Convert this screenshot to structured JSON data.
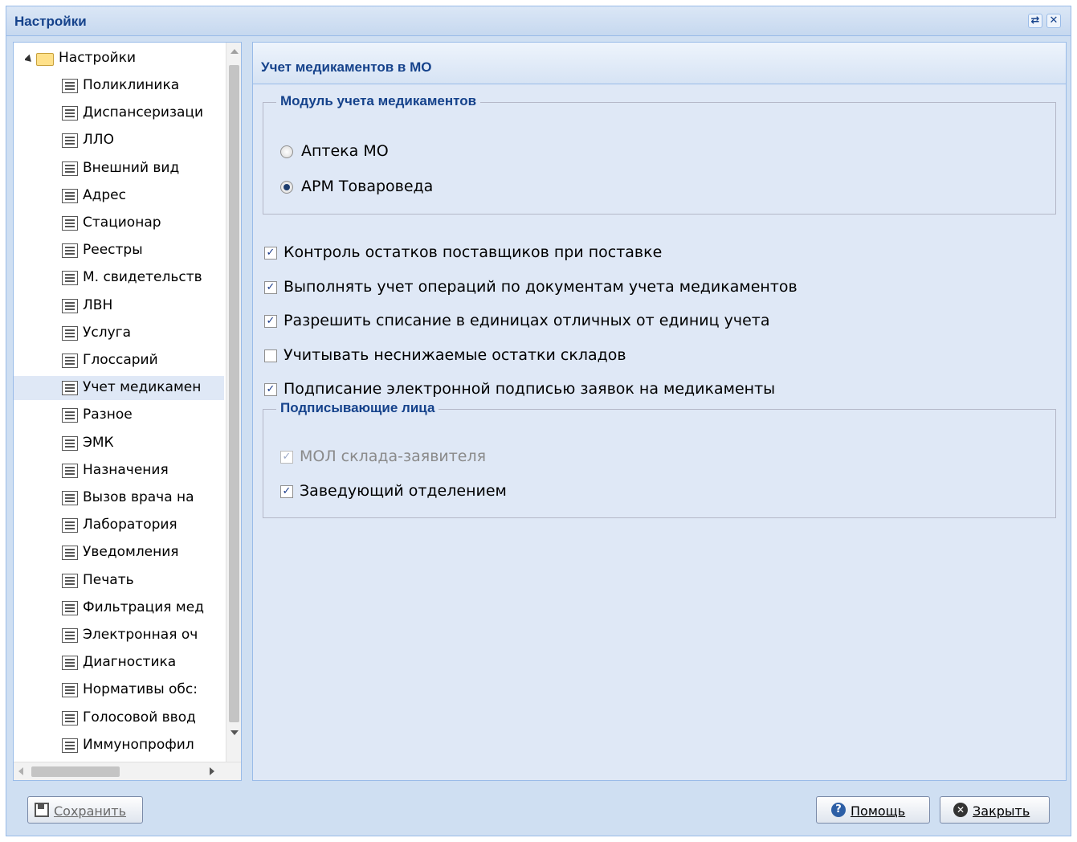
{
  "window": {
    "title": "Настройки"
  },
  "tree": {
    "root_label": "Настройки",
    "items": [
      "Поликлиника",
      "Диспансеризаци",
      "ЛЛО",
      "Внешний вид",
      "Адрес",
      "Стационар",
      "Реестры",
      "М. свидетельств",
      "ЛВН",
      "Услуга",
      "Глоссарий",
      "Учет медикамен",
      "Разное",
      "ЭМК",
      "Назначения",
      "Вызов врача на",
      "Лаборатория",
      "Уведомления",
      "Печать",
      "Фильтрация мед",
      "Электронная оч",
      "Диагностика",
      "Нормативы обс:",
      "Голосовой ввод",
      "Иммунопрофил"
    ],
    "selected": "Учет медикамен"
  },
  "panel": {
    "title": "Учет медикаментов в МО",
    "module_group": {
      "legend": "Модуль учета медикаментов",
      "options": [
        {
          "label": "Аптека МО",
          "checked": false
        },
        {
          "label": "АРМ Товароведа",
          "checked": true
        }
      ]
    },
    "checkboxes": [
      {
        "label": "Контроль остатков поставщиков при поставке",
        "checked": true
      },
      {
        "label": "Выполнять учет операций по документам учета медикаментов",
        "checked": true
      },
      {
        "label": "Разрешить списание в единицах отличных от единиц учета",
        "checked": true
      },
      {
        "label": "Учитывать неснижаемые остатки складов",
        "checked": false
      },
      {
        "label": "Подписание электронной подписью заявок на медикаменты",
        "checked": true
      }
    ],
    "signers_group": {
      "legend": "Подписывающие лица",
      "options": [
        {
          "label": "МОЛ склада-заявителя",
          "checked": true,
          "disabled": true
        },
        {
          "label": "Заведующий отделением",
          "checked": true,
          "disabled": false
        }
      ]
    }
  },
  "buttons": {
    "save": "Сохранить",
    "help": "Помощь",
    "close": "Закрыть"
  },
  "colors": {
    "title_text": "#15428b",
    "panel_bg": "#dfe8f6",
    "window_bg": "#cfdff2",
    "border": "#99bbe8"
  }
}
